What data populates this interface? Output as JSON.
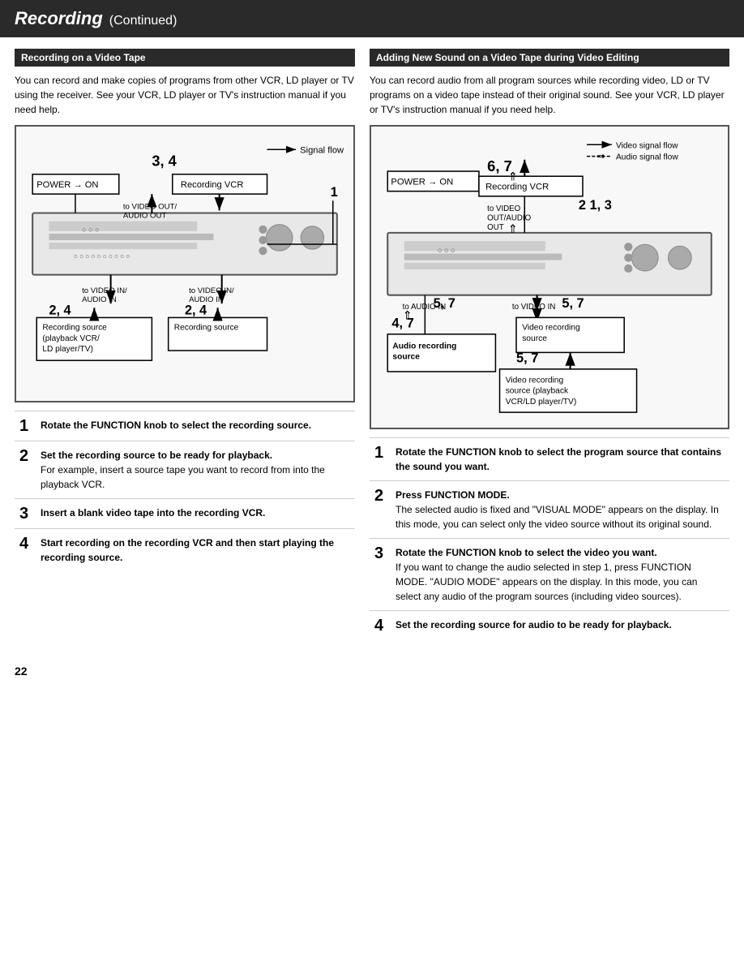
{
  "header": {
    "title_bold": "Recording",
    "title_normal": "(Continued)"
  },
  "left_section": {
    "heading": "Recording on a Video Tape",
    "intro": "You can record and make copies of programs from other VCR, LD player or TV using the receiver.  See your VCR, LD player or TV's instruction manual if you need help.",
    "diagram": {
      "signal_flow_label": "Signal flow",
      "power_label": "POWER → ON",
      "recording_vcr_label": "Recording VCR",
      "step34_label": "3, 4",
      "step24_label1": "2, 4",
      "step24_label2": "2, 4",
      "to_video_out": "to VIDEO OUT/ AUDIO OUT",
      "to_video_in1": "to VIDEO IN/ AUDIO IN",
      "to_video_in2": "to VIDEO IN/ AUDIO IN",
      "arrow1": "1",
      "source1_label": "Recording source\n(playback VCR/\nLD player/TV)",
      "source2_label": "Recording source"
    },
    "steps": [
      {
        "number": "1",
        "bold_text": "Rotate the FUNCTION knob to select the recording source.",
        "detail": ""
      },
      {
        "number": "2",
        "bold_text": "Set the recording source to be ready for playback.",
        "detail": "For example, insert a source tape you want to record from into the playback VCR."
      },
      {
        "number": "3",
        "bold_text": "Insert a blank video tape into the recording VCR.",
        "detail": ""
      },
      {
        "number": "4",
        "bold_text": "Start recording on the recording VCR and then start playing the recording source.",
        "detail": ""
      }
    ]
  },
  "right_section": {
    "heading": "Adding New Sound on a Video Tape during Video Editing",
    "intro": "You can record audio from all program sources while recording video, LD or TV programs on a video tape instead of their original sound.  See your VCR, LD player or TV's instruction manual if you need help.",
    "diagram": {
      "video_signal_flow": "Video signal flow",
      "audio_signal_flow": "Audio signal flow",
      "power_label": "POWER → ON",
      "recording_vcr_label": "Recording VCR",
      "step67_label": "6, 7",
      "step213_label": "2  1, 3",
      "step57_label1": "5, 7",
      "step57_label2": "5, 7",
      "step47_label": "4, 7",
      "to_video_out": "to VIDEO OUT/AUDIO OUT",
      "to_audio_in": "to AUDIO IN",
      "to_video_in": "to VIDEO IN",
      "video_recording_source": "Video recording source",
      "audio_recording_source": "Audio recording source",
      "video_recording_source_playback": "Video recording source (playback VCR/LD player/TV)"
    },
    "steps": [
      {
        "number": "1",
        "bold_text": "Rotate the FUNCTION knob to select the program source that contains the sound you want.",
        "detail": ""
      },
      {
        "number": "2",
        "bold_text": "Press FUNCTION MODE.",
        "detail": "The selected audio is fixed and \"VISUAL MODE\" appears on the display.  In this mode, you can select only the video source without its original sound."
      },
      {
        "number": "3",
        "bold_text": "Rotate the FUNCTION knob to select the video you want.",
        "detail": "If you want to change the audio selected in step 1, press FUNCTION MODE.  \"AUDIO MODE\" appears on the display.  In this mode, you can select any audio of the program sources (including video sources)."
      },
      {
        "number": "4",
        "bold_text": "Set the recording source for audio to be ready for playback.",
        "detail": ""
      }
    ]
  },
  "page_number": "22"
}
